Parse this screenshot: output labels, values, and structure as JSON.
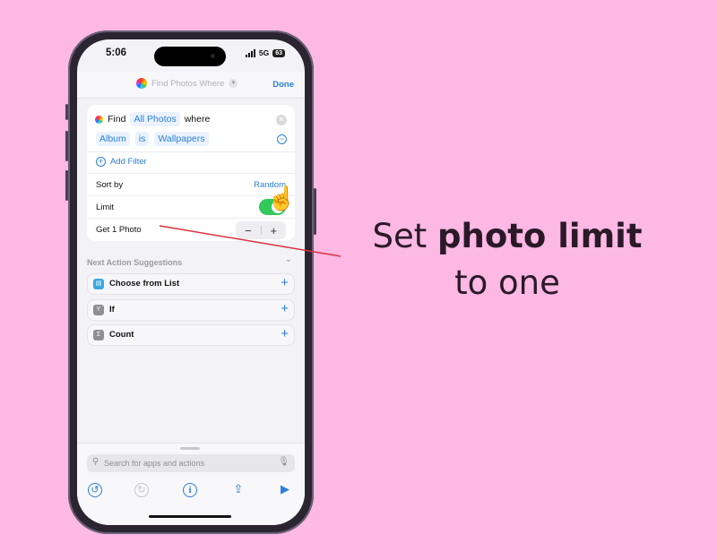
{
  "status_bar": {
    "time": "5:06",
    "network": "5G",
    "battery": "63"
  },
  "nav": {
    "title": "Find Photos Where",
    "done_label": "Done"
  },
  "find_card": {
    "find_label": "Find",
    "scope_token": "All Photos",
    "where_label": "where",
    "filter": {
      "field": "Album",
      "operator": "is",
      "value": "Wallpapers"
    },
    "add_filter_label": "Add Filter",
    "sort_label": "Sort by",
    "sort_value": "Random",
    "limit_label": "Limit",
    "limit_enabled": true,
    "get_label": "Get 1 Photo",
    "stepper_minus": "−",
    "stepper_plus": "+"
  },
  "suggestions": {
    "header": "Next Action Suggestions",
    "items": [
      {
        "label": "Choose from List",
        "icon": "list-icon",
        "color": "#3aa8e0",
        "glyph": "▤"
      },
      {
        "label": "If",
        "icon": "branch-icon",
        "color": "#8e8e93",
        "glyph": "Y"
      },
      {
        "label": "Count",
        "icon": "sigma-icon",
        "color": "#8e8e93",
        "glyph": "Σ"
      }
    ]
  },
  "bottom": {
    "search_placeholder": "Search for apps and actions"
  },
  "caption": {
    "pre": "Set ",
    "bold": "photo limit",
    "post": " to one"
  },
  "colors": {
    "accent": "#2a7fd8",
    "toggle_on": "#34c759",
    "background": "#fdb8e4",
    "pointer": "#d9343e"
  }
}
